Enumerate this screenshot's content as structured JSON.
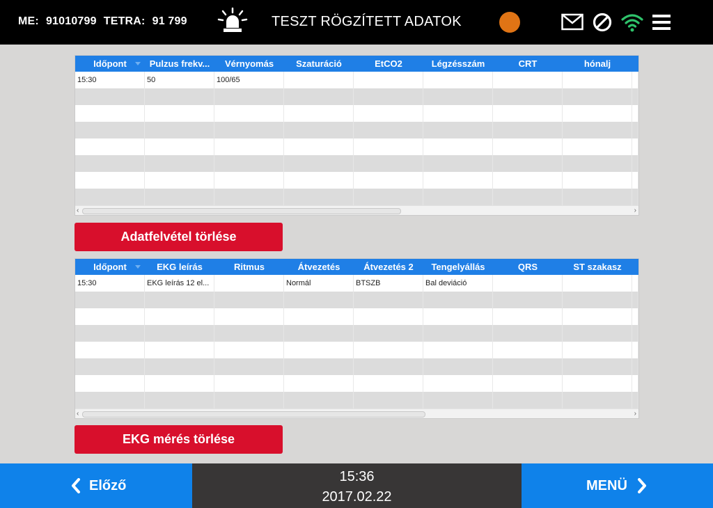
{
  "header": {
    "me_label": "ME:",
    "me_value": "91010799",
    "tetra_label": "TETRA:",
    "tetra_value": "91 799",
    "title": "TESZT RÖGZÍTETT ADATOK",
    "status_color": "#e07415"
  },
  "vitals_table": {
    "columns": [
      "Időpont",
      "Pulzus frekv...",
      "Vérnyomás",
      "Szaturáció",
      "EtCO2",
      "Légzésszám",
      "CRT",
      "hónalj"
    ],
    "rows": [
      [
        "15:30",
        "50",
        "100/65",
        "",
        "",
        "",
        "",
        ""
      ]
    ]
  },
  "vitals_delete_label": "Adatfelvétel törlése",
  "ekg_table": {
    "columns": [
      "Időpont",
      "EKG leírás",
      "Ritmus",
      "Átvezetés",
      "Átvezetés 2",
      "Tengelyállás",
      "QRS",
      "ST szakasz"
    ],
    "rows": [
      [
        "15:30",
        "EKG leírás 12 el...",
        "",
        "Normál",
        "BTSZB",
        "Bal deviáció",
        "",
        ""
      ]
    ]
  },
  "ekg_delete_label": "EKG mérés törlése",
  "footer": {
    "prev_label": "Előző",
    "time": "15:36",
    "date": "2017.02.22",
    "menu_label": "MENÜ"
  },
  "icons": {
    "siren": "siren-icon",
    "mail": "mail-icon",
    "block": "no-entry-icon",
    "wifi": "wifi-icon",
    "menu": "hamburger-menu-icon"
  },
  "colors": {
    "header_bg": "#000000",
    "table_header": "#1f7fe6",
    "delete_button": "#d80f2c",
    "nav_button": "#0f82ea",
    "wifi": "#2fc36b"
  }
}
